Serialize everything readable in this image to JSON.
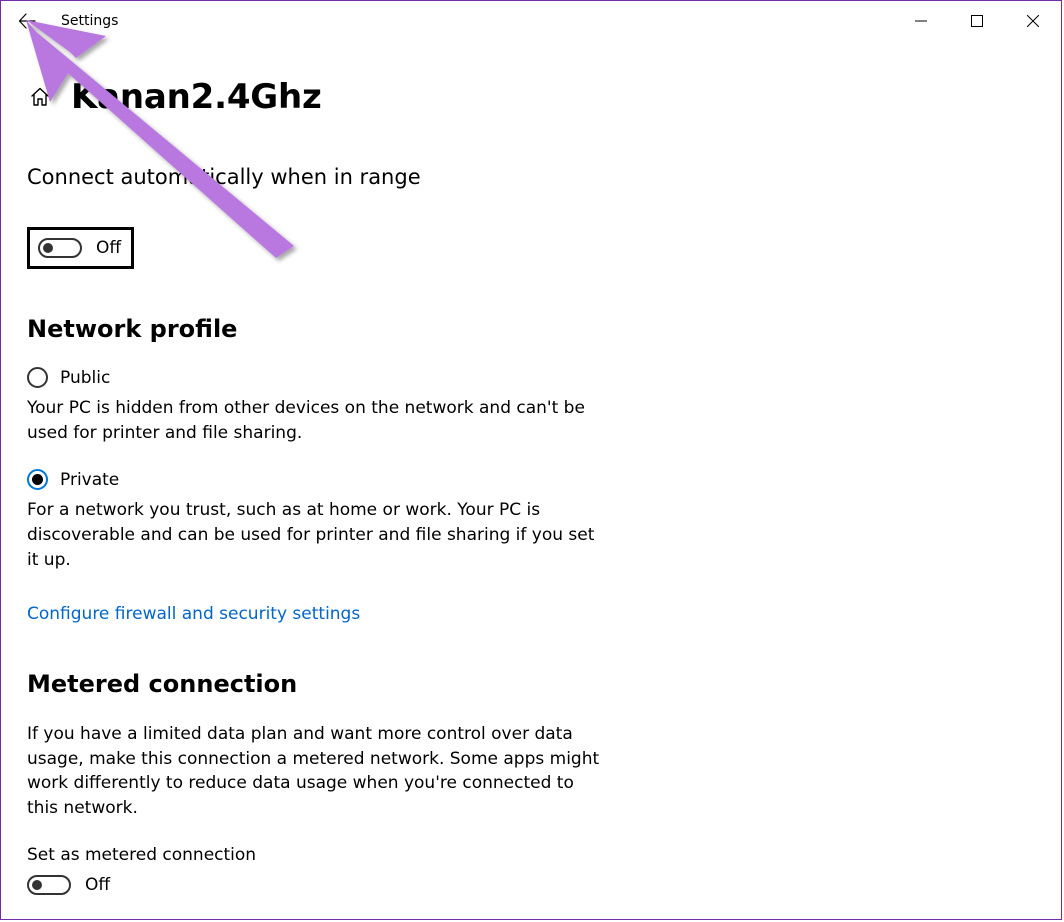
{
  "window": {
    "title": "Settings"
  },
  "page": {
    "title": "Kanan2.4Ghz"
  },
  "auto_connect": {
    "heading": "Connect automatically when in range",
    "state_label": "Off"
  },
  "network_profile": {
    "heading": "Network profile",
    "public": {
      "label": "Public",
      "desc": "Your PC is hidden from other devices on the network and can't be used for printer and file sharing."
    },
    "private": {
      "label": "Private",
      "desc": "For a network you trust, such as at home or work. Your PC is discoverable and can be used for printer and file sharing if you set it up."
    },
    "link": "Configure firewall and security settings"
  },
  "metered": {
    "heading": "Metered connection",
    "desc": "If you have a limited data plan and want more control over data usage, make this connection a metered network. Some apps might work differently to reduce data usage when you're connected to this network.",
    "sub_label": "Set as metered connection",
    "state_label": "Off"
  },
  "colors": {
    "accent": "#0078d4",
    "link": "#0066cc",
    "annotation": "#b878e0"
  }
}
